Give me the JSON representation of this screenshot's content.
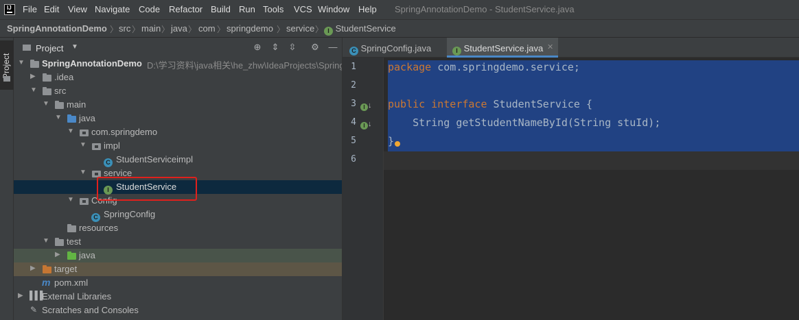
{
  "menu": [
    "File",
    "Edit",
    "View",
    "Navigate",
    "Code",
    "Refactor",
    "Build",
    "Run",
    "Tools",
    "VCS",
    "Window",
    "Help"
  ],
  "window_title": "SpringAnnotationDemo - StudentService.java",
  "breadcrumb": [
    "SpringAnnotationDemo",
    "src",
    "main",
    "java",
    "com",
    "springdemo",
    "service",
    "StudentService"
  ],
  "side_tab": "Project",
  "project_panel": {
    "title": "Project",
    "toolbar_icons": [
      "locate-icon",
      "expand-all-icon",
      "collapse-all-icon",
      "gear-icon",
      "minimize-icon"
    ]
  },
  "tree": {
    "root": "SpringAnnotationDemo",
    "root_path": "D:\\学习资料\\java相关\\he_zhw\\IdeaProjects\\SpringA",
    "idea": ".idea",
    "src": "src",
    "main": "main",
    "java": "java",
    "pkg": "com.springdemo",
    "impl": "impl",
    "impl_class": "StudentServiceimpl",
    "service": "service",
    "service_iface": "StudentService",
    "config": "Config",
    "config_class": "SpringConfig",
    "resources": "resources",
    "test": "test",
    "test_java": "java",
    "target": "target",
    "pom": "pom.xml",
    "libs": "External Libraries",
    "scratches": "Scratches and Consoles"
  },
  "tabs": [
    {
      "label": "SpringConfig.java",
      "icon": "class-icon"
    },
    {
      "label": "StudentService.java",
      "icon": "interface-icon",
      "active": true
    }
  ],
  "editor": {
    "line_numbers": [
      "1",
      "2",
      "3",
      "4",
      "5",
      "6"
    ],
    "l1_kw": "package",
    "l1_rest": " com.springdemo.service;",
    "l3_kw1": "public",
    "l3_kw2": "interface",
    "l3_rest": " StudentService {",
    "l4_text": "    String getStudentNameById(String stuId);",
    "l5_text": "}"
  },
  "colors": {
    "accent": "#4a88c7",
    "selection": "#214283",
    "highlight_box": "#e0201c",
    "keyword": "#cc7832"
  }
}
